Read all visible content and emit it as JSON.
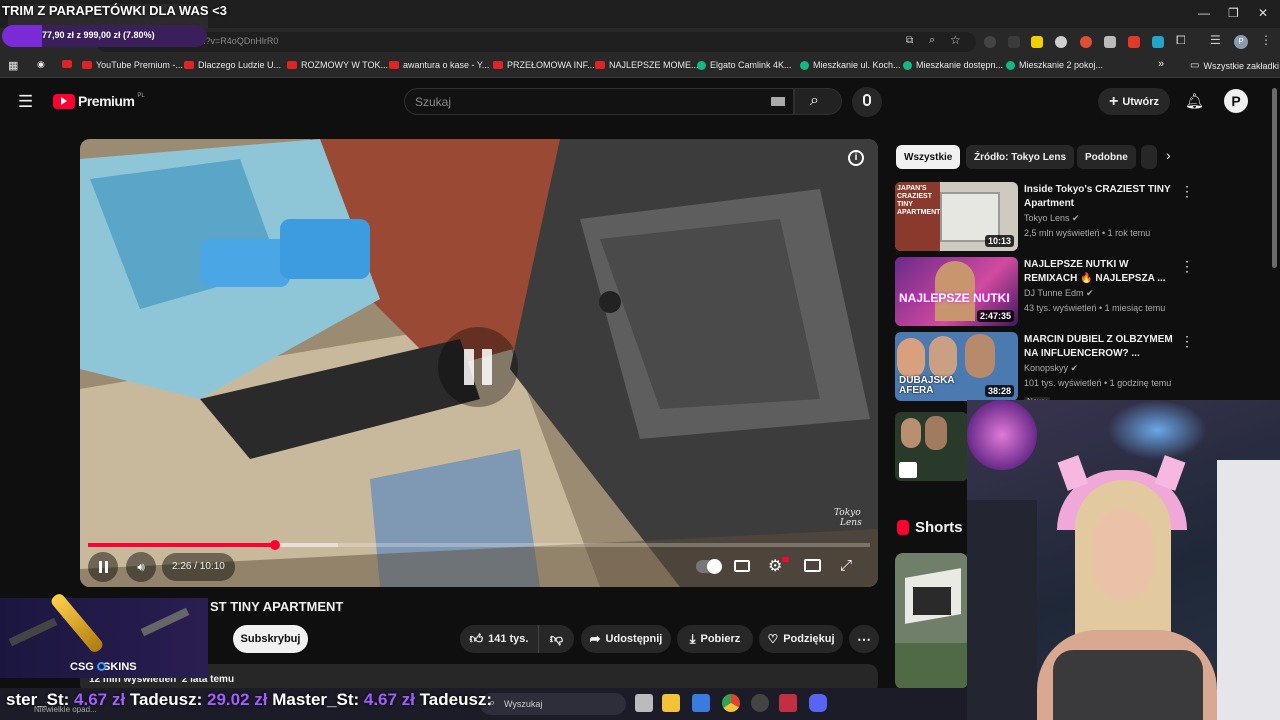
{
  "overlay": {
    "banner": "TRIM Z PARAPETÓWKI DLA WAS <3",
    "goal": "77,90 zł z 999,00 zł (7.80%)",
    "goal_progress": 0.078,
    "csgo_brand": "CSG   SKINS",
    "ticker": [
      "ster_St:",
      "4.67 zł",
      "Tadeusz:",
      "29.02 zł",
      "Master_St:",
      "4.67 zł",
      "Tadeusz:"
    ]
  },
  "browser": {
    "url": "youtube.com/watch?v=R4oQDnHlrR0",
    "bookmarks": [
      "YouTube Premium -...",
      "Dlaczego Ludzie U...",
      "ROZMOWY W TOK...",
      "awantura o kase - Y...",
      "PRZEŁOMOWA INF...",
      "NAJLEPSZE MOME...",
      "Elgato Camlink 4K...",
      "Mieszkanie ul. Koch...",
      "Mieszkanie dostępn...",
      "Mieszkanie 2 pokoj..."
    ],
    "all_bookmarks": "Wszystkie zakładki",
    "profile_letter": "P"
  },
  "header": {
    "logo": "Premium",
    "region": "PL",
    "search_placeholder": "Szukaj",
    "create_label": "Utwórz"
  },
  "player": {
    "time": "2:26 / 10:10",
    "progress": 0.239,
    "buffered": 0.32,
    "watermark_line1": "Tokyo",
    "watermark_line2": "Lens"
  },
  "video": {
    "title_visible": "ST TINY APARTMENT",
    "subscribe": "Subskrybuj",
    "likes": "141 tys.",
    "share": "Udostępnij",
    "download": "Pobierz",
    "thanks": "Podziękuj",
    "views": "12 mln wyświetleń  2 lata temu"
  },
  "chips": [
    "Wszystkie",
    "Źródło: Tokyo Lens",
    "Podobne"
  ],
  "recommendations": [
    {
      "title": "Inside Tokyo's CRAZIEST TINY Apartment",
      "channel": "Tokyo Lens",
      "meta": "2,5 mln wyświetleń • 1 rok temu",
      "duration": "10:13",
      "thumb_text": "JAPAN'S CRAZIEST TINY APARTMENT"
    },
    {
      "title": "NAJLEPSZE NUTKI W REMIXACH 🔥 NAJLEPSZA ...",
      "channel": "DJ Tunne Edm",
      "meta": "43 tys. wyświetleń • 1 miesiąc temu",
      "duration": "2:47:35",
      "thumb_text": "NAJLEPSZE NUTKI"
    },
    {
      "title": "MARCIN DUBIEL Z OLBZYMEM NA INFLUENCEROW? ...",
      "channel": "Konopskyy",
      "meta": "101 tys. wyświetleń • 1 godzinę temu",
      "duration": "38:28",
      "thumb_text": "DUBAJSKA AFERA",
      "badge": "Nowy"
    }
  ],
  "shorts_label": "Shorts",
  "taskbar": {
    "search_placeholder": "Wyszukaj",
    "weather": "Niewielkie opad..."
  },
  "colors": {
    "accent_red": "#ff0033",
    "overlay_purple": "#7a2bd6",
    "ticker_purple": "#a35cff"
  }
}
